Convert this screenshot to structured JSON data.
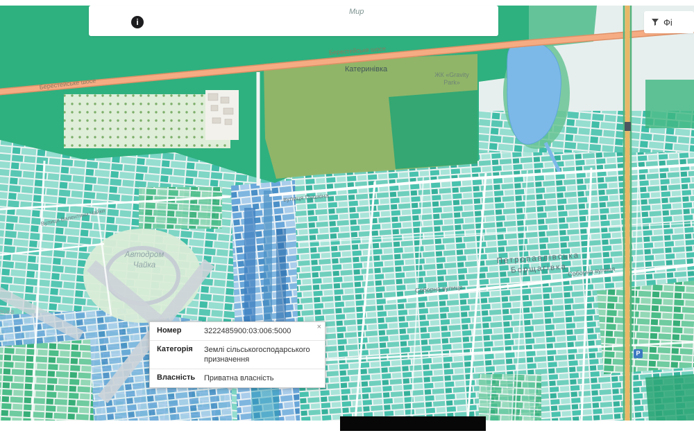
{
  "header": {
    "info_button": {
      "label": "i"
    },
    "filter": {
      "label": "Фі"
    }
  },
  "popup": {
    "close_label": "×",
    "rows": [
      {
        "label": "Номер",
        "value": "3222485900:03:006:5000"
      },
      {
        "label": "Категорія",
        "value": "Землі сільськогосподарського призначення"
      },
      {
        "label": "Власність",
        "value": "Приватна власність"
      }
    ]
  },
  "map": {
    "labels": {
      "myr": "Мир",
      "beresteiske_1": "Берестейське шосе",
      "beresteiske_2": "Берестейське шосе",
      "katerynivka": "Катеринівка",
      "gravity_line1": "ЖК «Gravity",
      "gravity_line2": "Park»",
      "pushkina": "вулиця Пушкіна",
      "avtodrom_line1": "Автодром",
      "avtodrom_line2": "Чайка",
      "valentyny": "Вулиця Валентини Чайки",
      "petropavlivska_line1": "Петропавлівська",
      "petropavlivska_line2": "Борщагівка",
      "soborna_1": "Соборна вулиця",
      "soborna_2": "Соборна вулиця",
      "chaika": "Чайка",
      "parking": "Р"
    },
    "colors": {
      "forest_green": "#2fb07f",
      "olive_green": "#96b567",
      "teal_parcel": "#49c2ae",
      "water_blue": "#7db9e8",
      "highway_orange": "#f6ac83",
      "road_yellow": "#e8b868"
    }
  }
}
